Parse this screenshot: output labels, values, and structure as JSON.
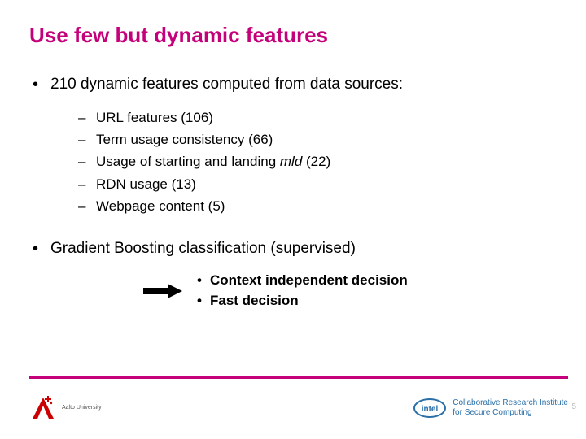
{
  "title": "Use few but dynamic features",
  "bullets": {
    "main1": "210 dynamic features computed from data sources:",
    "sub": [
      "URL features (106)",
      "Term usage consistency (66)",
      "Usage of starting and landing mld (22)",
      "RDN usage (13)",
      "Webpage content (5)"
    ],
    "main2": "Gradient Boosting classification (supervised)",
    "arrow": [
      "Context independent decision",
      "Fast decision"
    ]
  },
  "footer": {
    "aalto_line1": "Aalto University",
    "intel_line1": "Collaborative Research Institute",
    "intel_line2": "for Secure Computing"
  },
  "page_number": "5",
  "colors": {
    "accent": "#c4007a"
  }
}
